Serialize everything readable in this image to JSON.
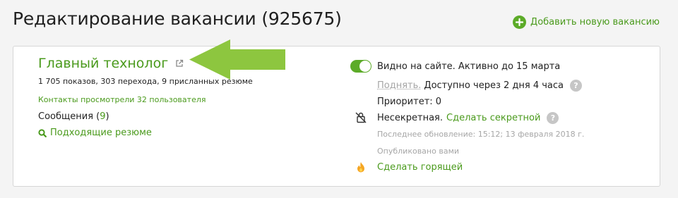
{
  "header": {
    "title": "Редактирование вакансии (925675)",
    "add_vacancy_label": "Добавить новую вакансию"
  },
  "vacancy": {
    "title": "Главный технолог",
    "stats": "1 705 показов, 303 перехода, 9 присланных резюме",
    "contacts_viewed": "Контакты просмотрели 32 пользователя",
    "messages_label": "Сообщения (",
    "messages_count": "9",
    "messages_suffix": ")",
    "matching_resumes": "Подходящие резюме"
  },
  "status": {
    "visibility": "Видно на сайте. Активно до 15 марта",
    "raise_label": "Поднять.",
    "raise_availability": "Доступно через 2 дня 4 часа",
    "priority": "Приоритет: 0",
    "secrecy": "Несекретная.",
    "make_secret": "Сделать секретной",
    "last_update": "Последнее обновление: 15:12; 13 февраля 2018 г.",
    "published_by": "Опубликовано вами",
    "make_hot": "Сделать горящей"
  },
  "colors": {
    "accent_green": "#4a9a1c",
    "toggle_green": "#5cab28",
    "arrow_green": "#8dc63f",
    "muted_gray": "#a6a6a6"
  },
  "icons": [
    "plus-circle-icon",
    "external-link-icon",
    "search-icon",
    "no-secret-icon",
    "help-icon",
    "fire-icon",
    "arrow-pointer-icon"
  ]
}
